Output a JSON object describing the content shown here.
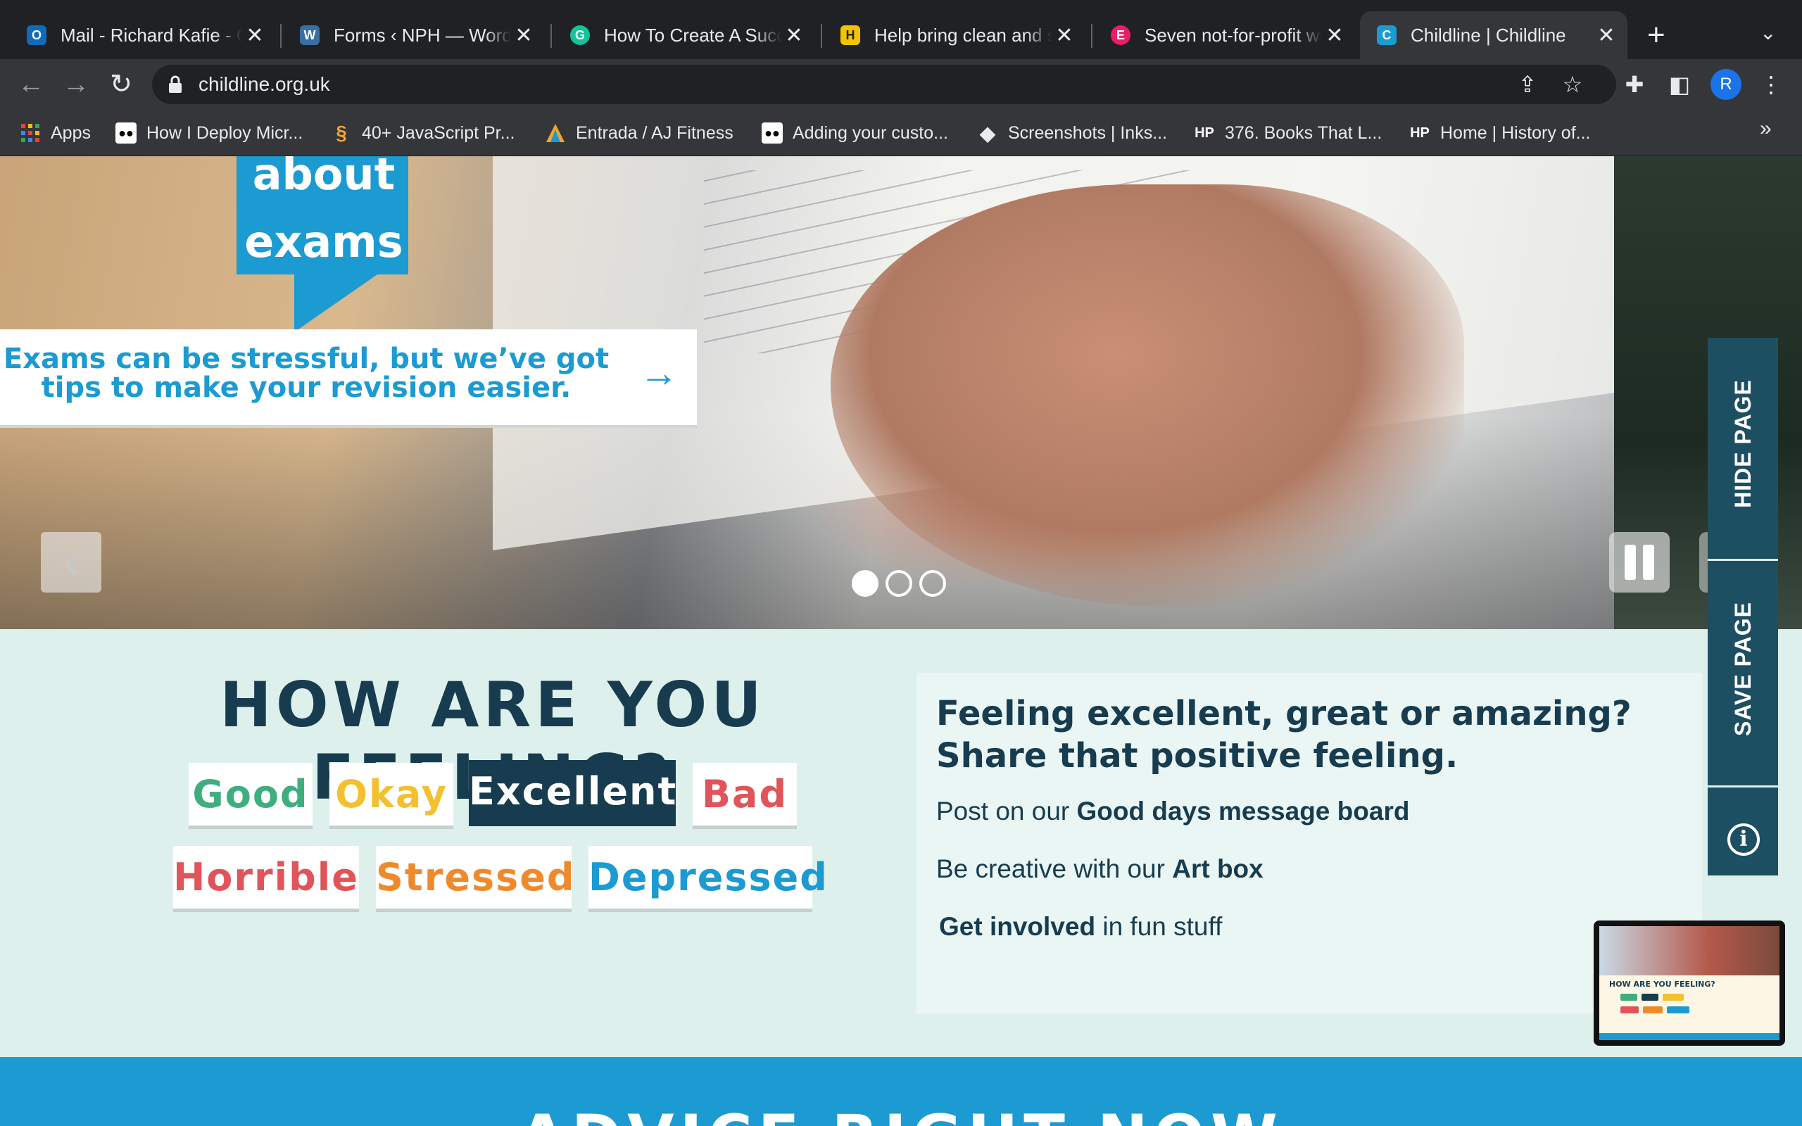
{
  "browser": {
    "tabs": [
      {
        "title": "Mail - Richard Kafie - Outlook",
        "favicon": "outlook-icon",
        "color": "#0f6cbd"
      },
      {
        "title": "Forms ‹ NPH — WordPress",
        "favicon": "wordpress-icon",
        "color": "#3b6ea5"
      },
      {
        "title": "How To Create A Successful",
        "favicon": "grammarly-icon",
        "color": "#15c39a"
      },
      {
        "title": "Help bring clean and safe water",
        "favicon": "charity-icon",
        "color": "#f2c400"
      },
      {
        "title": "Seven not-for-profit websites",
        "favicon": "e-icon",
        "color": "#e91e63"
      },
      {
        "title": "Childline | Childline",
        "favicon": "childline-icon",
        "color": "#1b9bd1",
        "active": true
      }
    ],
    "url": "childline.org.uk",
    "profile_initial": "R",
    "bookmarks": [
      {
        "label": "Apps",
        "icon": "apps-grid-icon"
      },
      {
        "label": "How I Deploy Micr...",
        "icon": "medium-icon"
      },
      {
        "label": "40+ JavaScript Pr...",
        "icon": "swirl-icon"
      },
      {
        "label": "Entrada / AJ Fitness",
        "icon": "triangle-icon"
      },
      {
        "label": "Adding your custo...",
        "icon": "medium-icon"
      },
      {
        "label": "Screenshots | Inks...",
        "icon": "inkscape-icon"
      },
      {
        "label": "376. Books That L...",
        "icon": "hp-icon"
      },
      {
        "label": "Home | History of...",
        "icon": "hp-icon"
      }
    ]
  },
  "hero": {
    "headline_line1": "about",
    "headline_line2": "exams",
    "caption": "Exams can be stressful, but we’ve got tips to make your revision easier.",
    "slide_count": 3,
    "active_slide": 1
  },
  "feelings": {
    "title": "HOW ARE YOU FEELING?",
    "moods": [
      {
        "label": "Good",
        "color": "#3fae7e"
      },
      {
        "label": "Okay",
        "color": "#f3c030"
      },
      {
        "label": "Excellent",
        "color": "#ffffff",
        "selected": true
      },
      {
        "label": "Bad",
        "color": "#e0545a"
      },
      {
        "label": "Horrible",
        "color": "#e0545a"
      },
      {
        "label": "Stressed",
        "color": "#ef8a2c"
      },
      {
        "label": "Depressed",
        "color": "#1b9bd1"
      }
    ]
  },
  "info": {
    "title": "Feeling excellent, great or amazing? Share that positive feeling.",
    "row1_prefix": "Post on our",
    "row1_link": "Good days message board",
    "row2_prefix": "Be creative with our",
    "row2_link": "Art box",
    "row3_link": "Get involved",
    "row3_suffix": "in fun stuff"
  },
  "rail": {
    "hide_label": "HIDE PAGE",
    "save_label": "SAVE PAGE"
  },
  "thumbnail": {
    "title": "HOW ARE YOU FEELING?"
  },
  "footer": {
    "heading": "ADVICE RIGHT NOW"
  },
  "colors": {
    "brand_blue": "#1b9bd1",
    "dark_teal": "#173c4f",
    "mint_bg": "#ddf0ec"
  }
}
